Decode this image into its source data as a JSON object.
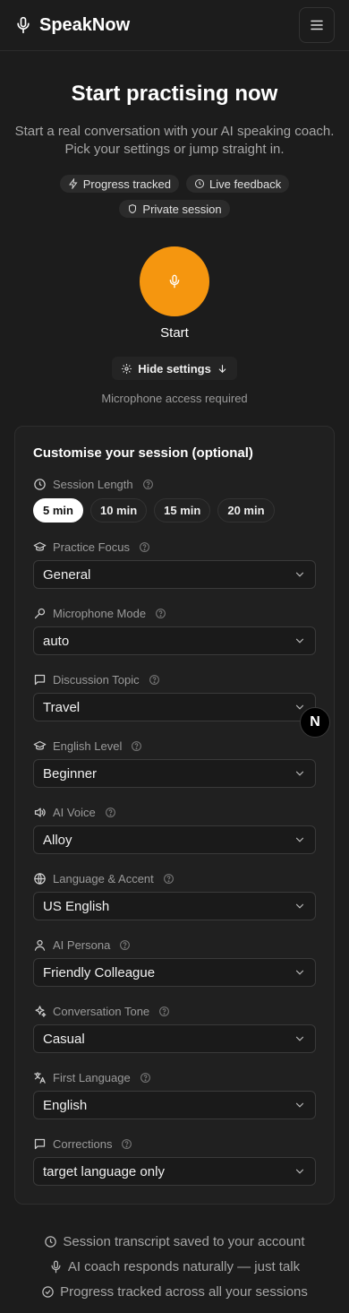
{
  "header": {
    "brand": "SpeakNow"
  },
  "hero": {
    "title": "Start practising now",
    "subtitle": "Start a real conversation with your AI speaking coach. Pick your settings or jump straight in.",
    "chips": [
      "Progress tracked",
      "Live feedback",
      "Private session"
    ]
  },
  "start": {
    "label": "Start",
    "hide_settings": "Hide settings",
    "mic_note": "Microphone access required"
  },
  "settings": {
    "title": "Customise your session (optional)",
    "session_length": {
      "label": "Session Length",
      "options": [
        "5 min",
        "10 min",
        "15 min",
        "20 min"
      ],
      "selected": "5 min"
    },
    "fields": [
      {
        "label": "Practice Focus",
        "value": "General",
        "icon": "graduation-cap-icon"
      },
      {
        "label": "Microphone Mode",
        "value": "auto",
        "icon": "mic-pen-icon"
      },
      {
        "label": "Discussion Topic",
        "value": "Travel",
        "icon": "message-icon"
      },
      {
        "label": "English Level",
        "value": "Beginner",
        "icon": "graduation-cap-icon"
      },
      {
        "label": "AI Voice",
        "value": "Alloy",
        "icon": "speaker-icon"
      },
      {
        "label": "Language & Accent",
        "value": "US English",
        "icon": "globe-icon"
      },
      {
        "label": "AI Persona",
        "value": "Friendly Colleague",
        "icon": "user-icon"
      },
      {
        "label": "Conversation Tone",
        "value": "Casual",
        "icon": "sparkles-icon"
      },
      {
        "label": "First Language",
        "value": "English",
        "icon": "translate-icon"
      },
      {
        "label": "Corrections",
        "value": "target language only",
        "icon": "message-icon"
      }
    ]
  },
  "footer": {
    "notes": [
      "Session transcript saved to your account",
      "AI coach responds naturally — just talk",
      "Progress tracked across all your sessions"
    ]
  },
  "badge": {
    "letter": "N"
  },
  "colors": {
    "accent": "#f5960f",
    "background": "#1c1c1c"
  }
}
